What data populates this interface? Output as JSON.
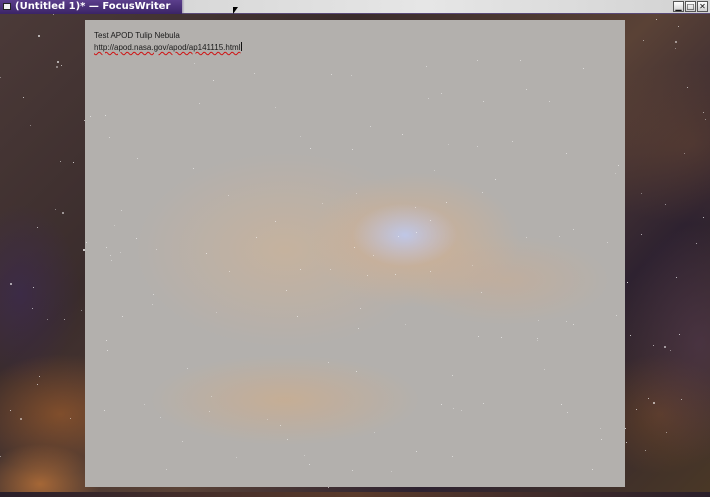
{
  "window": {
    "title": "(Untitled 1)* — FocusWriter",
    "controls": {
      "minimize_icon": "minimize-icon",
      "maximize_icon": "maximize-icon",
      "close_icon": "close-icon",
      "minimize_glyph": "▁",
      "maximize_glyph": "□",
      "close_glyph": "✕"
    }
  },
  "document": {
    "lines": [
      "Test APOD Tulip Nebula",
      "http://apod.nasa.gov/apod/ap141115.html"
    ]
  },
  "theme": {
    "titlebar_accent": "#4a3470",
    "spellcheck_underline": "#d01010",
    "text_color": "#1a1a1a"
  }
}
